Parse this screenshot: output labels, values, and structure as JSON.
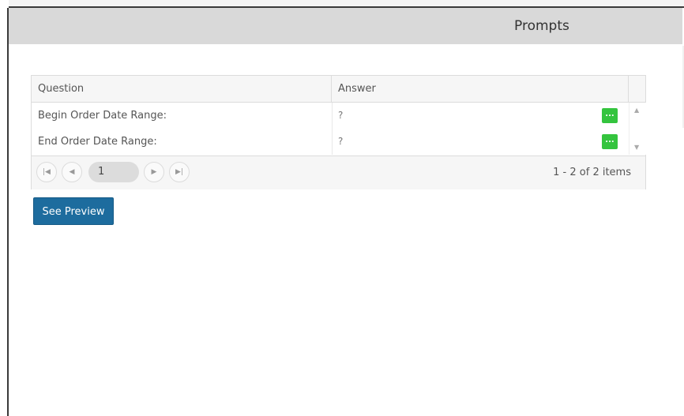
{
  "dialog": {
    "title": "Prompts"
  },
  "grid": {
    "columns": [
      "Question",
      "Answer"
    ],
    "rows": [
      {
        "question": "Begin Order Date Range:",
        "answer": "?",
        "action": "..."
      },
      {
        "question": "End Order Date Range:",
        "answer": "?",
        "action": "..."
      }
    ],
    "pager": {
      "first_icon": "first-page-icon",
      "prev_icon": "prev-page-icon",
      "next_icon": "next-page-icon",
      "last_icon": "last-page-icon",
      "current_page": "1",
      "info": "1 - 2 of 2 items"
    }
  },
  "actions": {
    "preview_label": "See Preview"
  },
  "colors": {
    "title_bar": "#d9d9d9",
    "action_button": "#34c43e",
    "primary_button": "#1d6c9e"
  }
}
